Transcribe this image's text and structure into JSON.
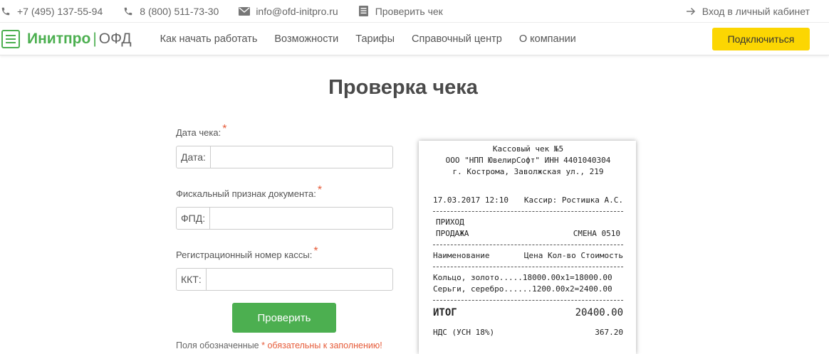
{
  "topbar": {
    "phone1": "+7 (495) 137-55-94",
    "phone2": "8 (800) 511-73-30",
    "email": "info@ofd-initpro.ru",
    "check_receipt": "Проверить чек",
    "login": "Вход в личный кабинет"
  },
  "nav": {
    "brand": "Инитпро",
    "brand_sep": "|",
    "brand_suffix": "ОФД",
    "items": [
      "Как начать работать",
      "Возможности",
      "Тарифы",
      "Справочный центр",
      "О компании"
    ],
    "connect_label": "Подключиться"
  },
  "page": {
    "title": "Проверка чека"
  },
  "form": {
    "date_label": "Дата чека:",
    "date_prefix": "Дата:",
    "fpd_label": "Фискальный признак документа:",
    "fpd_prefix": "ФПД:",
    "kkt_label": "Регистрационный номер кассы:",
    "kkt_prefix": "ККТ:",
    "required_mark": "*",
    "date_value": "",
    "fpd_value": "",
    "kkt_value": "",
    "submit_label": "Проверить",
    "footnote_prefix": "Поля обозначенные",
    "footnote_star": "*",
    "footnote_suffix": "обязательны к заполнению!"
  },
  "receipt": {
    "title": "Кассовый чек №5",
    "org": "ООО \"НПП ЮвелирСофт\" ИНН 4401040304",
    "address": "г. Кострома, Заволжская ул., 219",
    "datetime": "17.03.2017 12:10",
    "cashier": "Кассир: Ростишка А.С.",
    "type1": "ПРИХОД",
    "type2": "ПРОДАЖА",
    "shift": "СМЕНА 0510",
    "col_name": "Наименование",
    "col_rest": "Цена Кол-во Стоимость",
    "items": [
      "Кольцо, золото.....18000.00x1=18000.00",
      "Серьги, серебро......1200.00x2=2400.00"
    ],
    "total_label": "ИТОГ",
    "total_value": "20400.00",
    "vat_label": "НДС (УСН 18%)",
    "vat_value": "367.20"
  },
  "colors": {
    "brand_green": "#4caf50",
    "connect_yellow": "#fcd602",
    "required_red": "#e65c3a"
  }
}
